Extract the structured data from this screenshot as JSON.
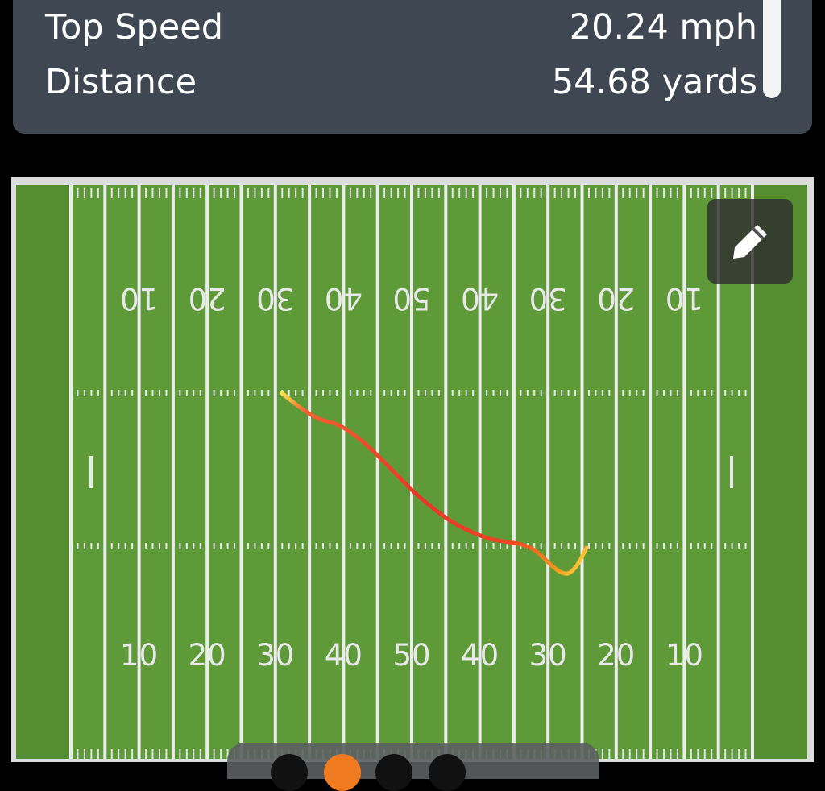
{
  "stats": {
    "top_speed_label": "Top Speed",
    "top_speed_value": "20.24 mph",
    "distance_label": "Distance",
    "distance_value": "54.68 yards"
  },
  "field": {
    "top_yard_numbers": [
      "10",
      "20",
      "30",
      "40",
      "50",
      "40",
      "30",
      "20",
      "10"
    ],
    "bottom_yard_numbers": [
      "10",
      "20",
      "30",
      "40",
      "50",
      "40",
      "30",
      "20",
      "10"
    ],
    "route_colors": {
      "start": "#ffe14a",
      "middle": "#e8352a",
      "end": "#ffd21e"
    }
  },
  "toolbar": {
    "edit_icon": "pencil-icon"
  },
  "colors": {
    "card_background": "#3e4752",
    "field_green": "#5e9b38",
    "accent_orange": "#f07a1f"
  }
}
